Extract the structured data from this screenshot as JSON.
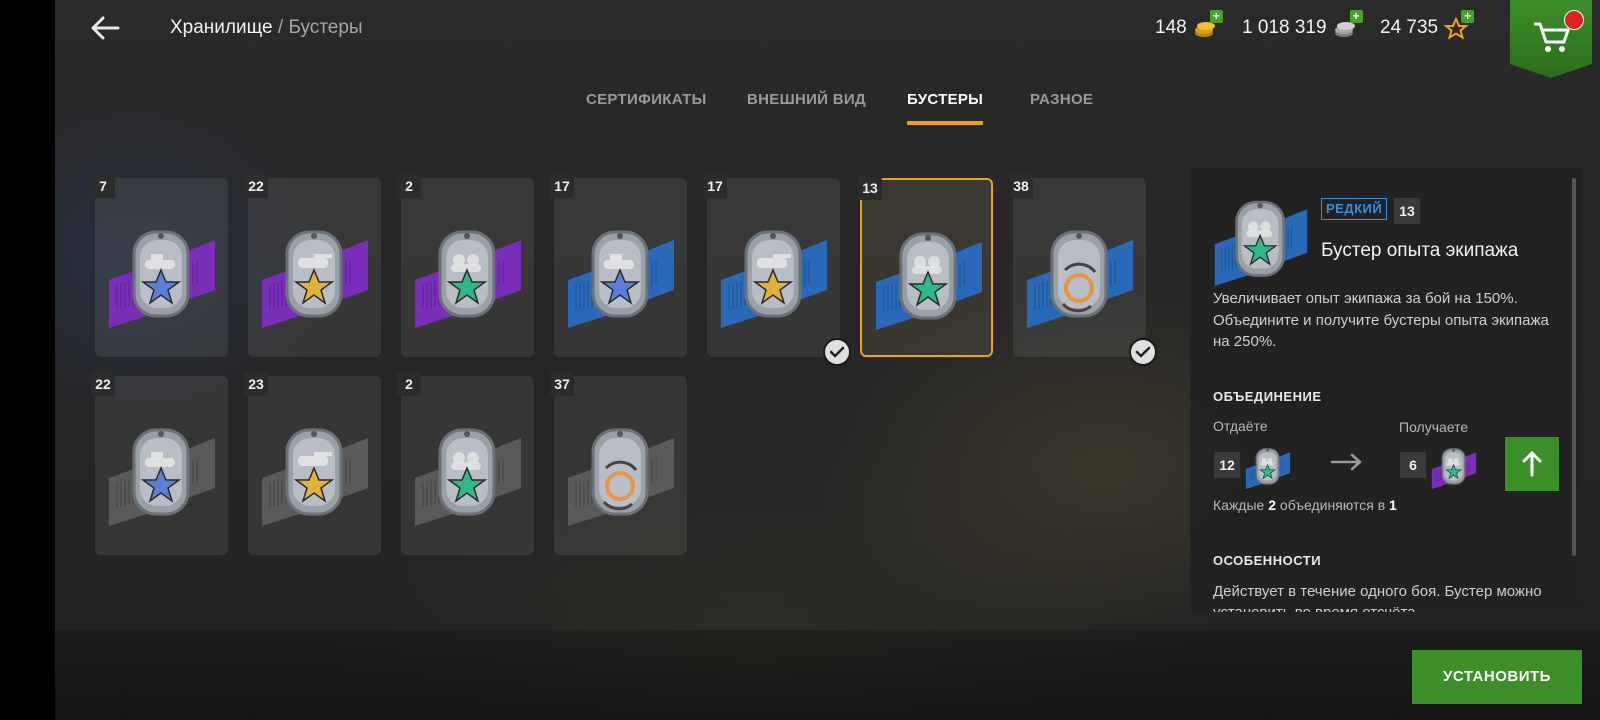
{
  "header": {
    "breadcrumb_root": "Хранилище",
    "breadcrumb_sep": " / ",
    "breadcrumb_current": "Бустеры"
  },
  "currencies": [
    {
      "name": "gold",
      "value": "148",
      "icon": "gold-coins-icon"
    },
    {
      "name": "credits",
      "value": "1 018 319",
      "icon": "silver-coins-icon"
    },
    {
      "name": "free-xp",
      "value": "24 735",
      "icon": "star-icon"
    }
  ],
  "tabs": [
    {
      "label": "СЕРТИФИКАТЫ",
      "active": false
    },
    {
      "label": "ВНЕШНИЙ ВИД",
      "active": false
    },
    {
      "label": "БУСТЕРЫ",
      "active": true
    },
    {
      "label": "РАЗНОЕ",
      "active": false
    }
  ],
  "boosters": [
    {
      "count": "7",
      "type": "vehicle",
      "star": "blue",
      "band": "purple"
    },
    {
      "count": "22",
      "type": "tank",
      "star": "gold",
      "band": "purple"
    },
    {
      "count": "2",
      "type": "crew",
      "star": "green",
      "band": "purple"
    },
    {
      "count": "17",
      "type": "vehicle",
      "star": "blue",
      "band": "blue"
    },
    {
      "count": "17",
      "type": "tank",
      "star": "gold",
      "band": "blue",
      "equipped": true
    },
    {
      "count": "13",
      "type": "crew",
      "star": "green",
      "band": "blue",
      "selected": true
    },
    {
      "count": "38",
      "type": "cycle",
      "star": "orange",
      "band": "blue",
      "equipped": true
    },
    {
      "count": "22",
      "type": "vehicle",
      "star": "blue",
      "band": "gray"
    },
    {
      "count": "23",
      "type": "tank",
      "star": "gold",
      "band": "gray"
    },
    {
      "count": "2",
      "type": "crew",
      "star": "green",
      "band": "gray"
    },
    {
      "count": "37",
      "type": "cycle",
      "star": "orange",
      "band": "gray"
    }
  ],
  "details": {
    "rarity": "РЕДКИЙ",
    "count": "13",
    "title": "Бустер опыта экипажа",
    "description": "Увеличивает опыт экипажа за бой на 150%. Объедините и получите бустеры опыта экипажа на 250%.",
    "merge_heading": "ОБЪЕДИНЕНИЕ",
    "give_label": "Отдаёте",
    "give_count": "12",
    "get_label": "Получаете",
    "get_count": "6",
    "rule_prefix": "Каждые ",
    "rule_from": "2",
    "rule_mid": " объединяются в ",
    "rule_to": "1",
    "features_heading": "ОСОБЕННОСТИ",
    "features_text": "Действует в течение одного боя. Бустер можно установить во время отсчёта"
  },
  "actions": {
    "install_label": "УСТАНОВИТЬ"
  },
  "colors": {
    "accent": "#f0a020",
    "green": "#3d8f2a",
    "rarity_blue": "#3a8ee0"
  }
}
